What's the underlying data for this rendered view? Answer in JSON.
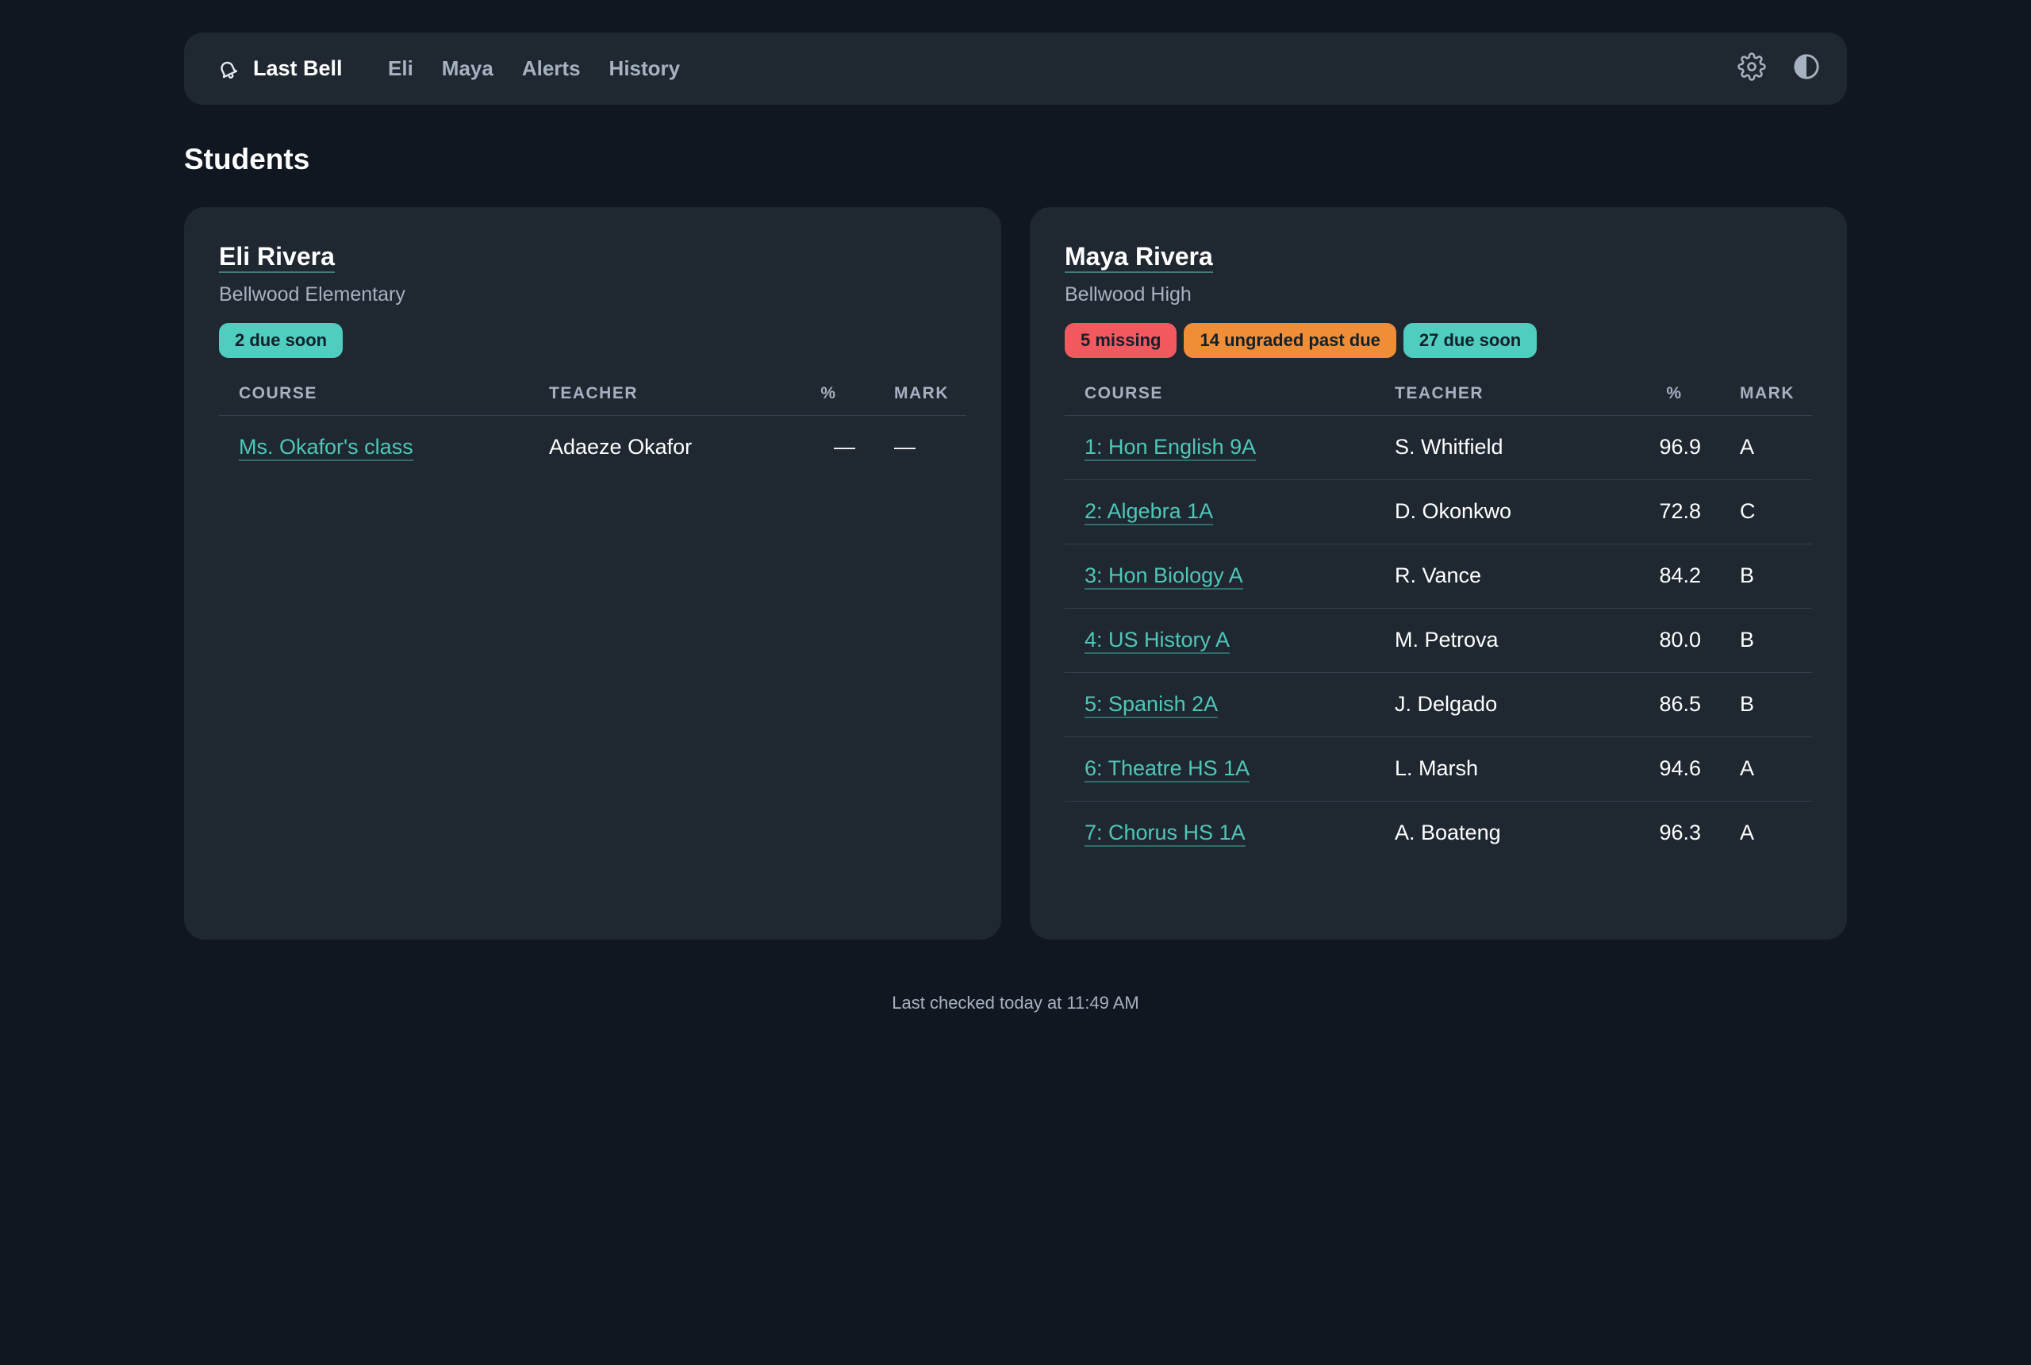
{
  "app": {
    "brand": "Last Bell"
  },
  "nav": {
    "links": [
      "Eli",
      "Maya",
      "Alerts",
      "History"
    ]
  },
  "colors": {
    "background": "#111720",
    "card": "#1f2731",
    "accent": "#4fcdbf",
    "missing": "#f2595f",
    "ungraded": "#f08d37"
  },
  "icons": {
    "brand": "bell-icon",
    "settings": "gear-icon",
    "theme": "contrast-icon"
  },
  "page": {
    "title": "Students"
  },
  "table_headers": {
    "course": "COURSE",
    "teacher": "TEACHER",
    "pct": "%",
    "mark": "MARK"
  },
  "students": {
    "eli": {
      "name": "Eli Rivera",
      "school": "Bellwood Elementary",
      "badges": {
        "due_soon": "2 due soon"
      },
      "courses": [
        {
          "course": "Ms. Okafor's class",
          "teacher": "Adaeze Okafor",
          "pct": "—",
          "mark": "—"
        }
      ]
    },
    "maya": {
      "name": "Maya Rivera",
      "school": "Bellwood High",
      "badges": {
        "missing": "5 missing",
        "ungraded": "14 ungraded past due",
        "due_soon": "27 due soon"
      },
      "courses": [
        {
          "course": "1: Hon English 9A",
          "teacher": "S. Whitfield",
          "pct": "96.9",
          "mark": "A"
        },
        {
          "course": "2: Algebra 1A",
          "teacher": "D. Okonkwo",
          "pct": "72.8",
          "mark": "C"
        },
        {
          "course": "3: Hon Biology A",
          "teacher": "R. Vance",
          "pct": "84.2",
          "mark": "B"
        },
        {
          "course": "4: US History A",
          "teacher": "M. Petrova",
          "pct": "80.0",
          "mark": "B"
        },
        {
          "course": "5: Spanish 2A",
          "teacher": "J. Delgado",
          "pct": "86.5",
          "mark": "B"
        },
        {
          "course": "6: Theatre HS 1A",
          "teacher": "L. Marsh",
          "pct": "94.6",
          "mark": "A"
        },
        {
          "course": "7: Chorus HS 1A",
          "teacher": "A. Boateng",
          "pct": "96.3",
          "mark": "A"
        }
      ]
    }
  },
  "footer": {
    "status": "Last checked today at 11:49 AM"
  }
}
